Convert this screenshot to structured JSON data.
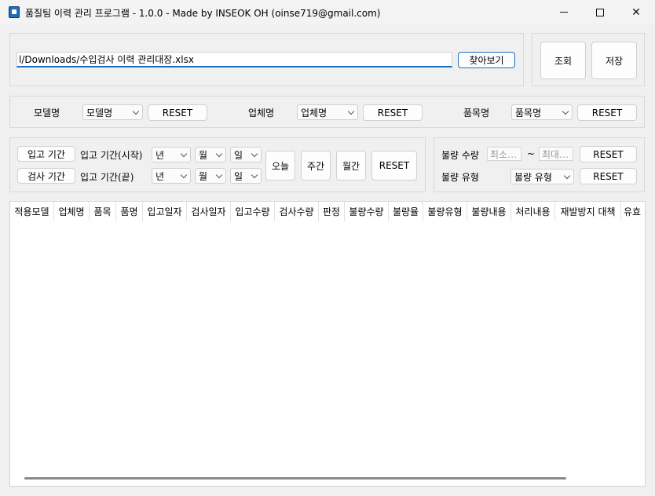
{
  "window": {
    "title": "품질팀 이력 관리 프로그램 - 1.0.0 - Made by INSEOK OH (oinse719@gmail.com)"
  },
  "file": {
    "path": "l/Downloads/수입검사 이력 관리대장.xlsx",
    "browse_label": "찾아보기"
  },
  "actions": {
    "search_label": "조회",
    "save_label": "저장"
  },
  "filters": {
    "model_label": "모델명",
    "model_value": "모델명",
    "vendor_label": "업체명",
    "vendor_value": "업체명",
    "item_label": "품목명",
    "item_value": "품목명",
    "reset_label": "RESET"
  },
  "date": {
    "receive_period_btn": "입고 기간",
    "inspect_period_btn": "검사 기간",
    "start_label": "입고 기간(시작)",
    "end_label": "입고 기간(끝)",
    "year": "년",
    "month": "월",
    "day": "일",
    "today_btn": "오늘",
    "week_btn": "주간",
    "month_btn": "월간",
    "reset_label": "RESET"
  },
  "defect": {
    "qty_label": "불량 수량",
    "min_placeholder": "최소…",
    "tilde": "~",
    "max_placeholder": "최대…",
    "type_label": "불량 유형",
    "type_value": "불량 유형",
    "reset_label": "RESET"
  },
  "table": {
    "columns": [
      "적용모델",
      "업체명",
      "품목",
      "품명",
      "입고일자",
      "검사일자",
      "입고수량",
      "검사수량",
      "판정",
      "불량수량",
      "불량율",
      "불량유형",
      "불량내용",
      "처리내용",
      "재발방지 대책",
      "유효"
    ]
  }
}
